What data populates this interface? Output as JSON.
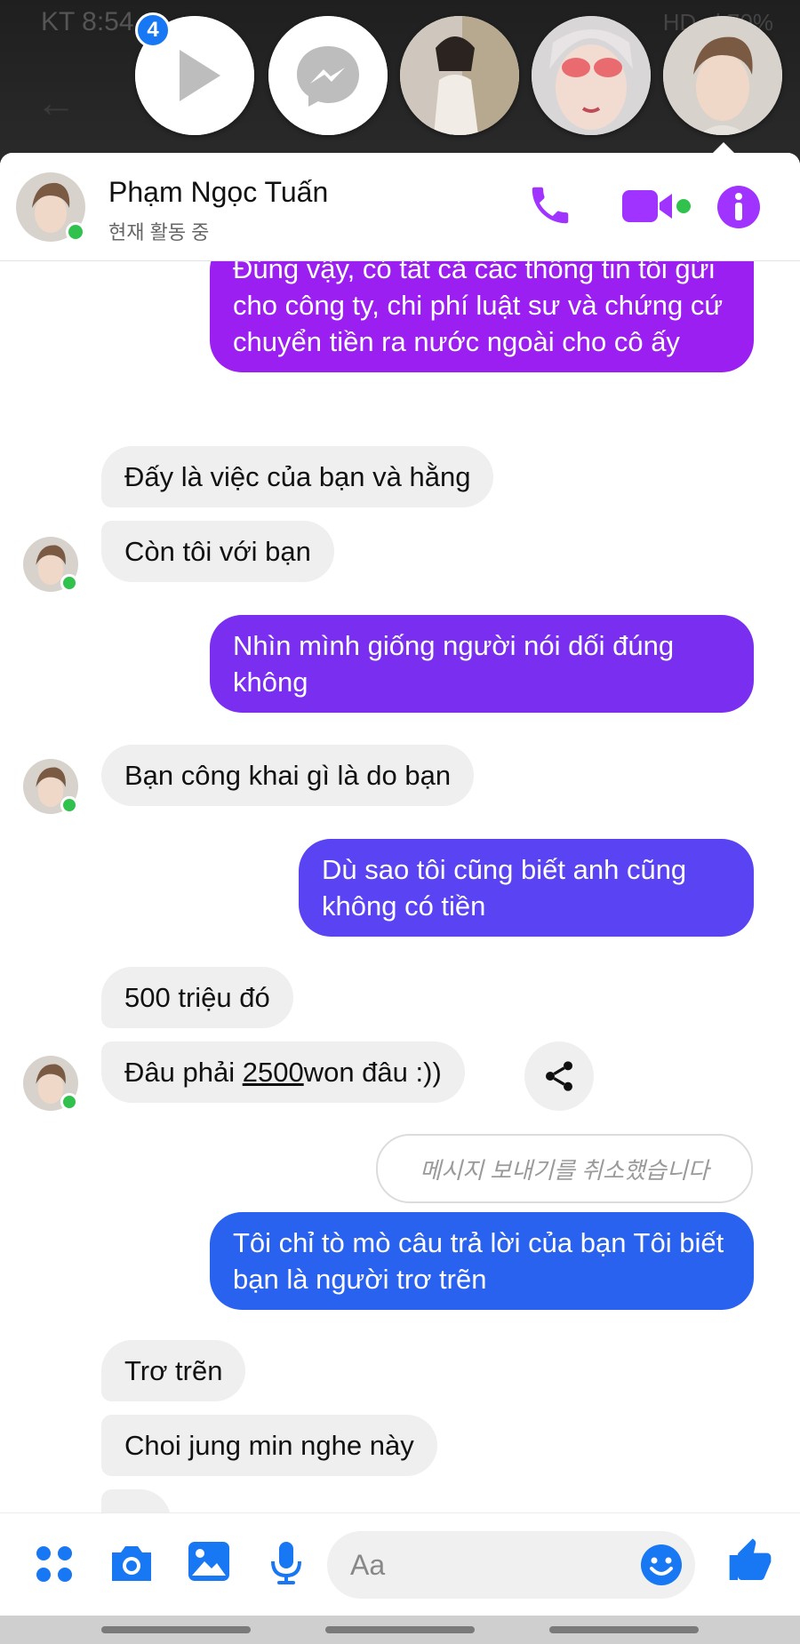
{
  "status_bar": {
    "time": "KT 8:54",
    "right": "HD .ıl 70%"
  },
  "chat_heads": {
    "badge_count": "4",
    "items": [
      "video-play",
      "messenger",
      "contact-photo-1",
      "contact-photo-2",
      "contact-photo-3"
    ]
  },
  "header": {
    "name": "Phạm Ngọc Tuấn",
    "status": "현재 활동 중",
    "icons": [
      "phone-icon",
      "video-call-icon",
      "info-icon"
    ],
    "accent_color": "#a033ff",
    "online_color": "#31c24d"
  },
  "messages": [
    {
      "dir": "out",
      "text": "Đúng vậy, có tất cả các thông tin tôi gửi cho công ty, chi phí luật sư và chứng cứ chuyển tiền ra nước ngoài cho cô ấy",
      "color": "#9b1ff0"
    },
    {
      "dir": "in",
      "text": "Đấy là việc của bạn và hằng"
    },
    {
      "dir": "in",
      "text": "Còn tôi với bạn"
    },
    {
      "dir": "out",
      "text": "Nhìn mình giống người nói dối đúng không",
      "color": "#7a2ff0"
    },
    {
      "dir": "in",
      "text": "Bạn công khai gì là do bạn"
    },
    {
      "dir": "out",
      "text": "Dù sao tôi cũng biết anh cũng không có tiền",
      "color": "#5a43f2"
    },
    {
      "dir": "in",
      "text": "500 triệu đó"
    },
    {
      "dir": "in",
      "text_before": "Đâu phải ",
      "text_link": "2500",
      "text_after": "won đâu :))"
    },
    {
      "dir": "unsent",
      "text": "메시지 보내기를 취소했습니다"
    },
    {
      "dir": "out",
      "text": "Tôi chỉ tò mò câu trả lời của bạn Tôi biết bạn là người trơ trẽn",
      "color": "#2a62f0"
    },
    {
      "dir": "in",
      "text": "Trơ trẽn"
    },
    {
      "dir": "in",
      "text": "Choi jung min nghe này"
    },
    {
      "dir": "in",
      "text": "..."
    }
  ],
  "composer": {
    "placeholder": "Aa",
    "icons": [
      "apps-icon",
      "camera-icon",
      "gallery-icon",
      "microphone-icon",
      "emoji-icon",
      "thumbs-up-icon"
    ],
    "icon_color": "#1877f2"
  }
}
